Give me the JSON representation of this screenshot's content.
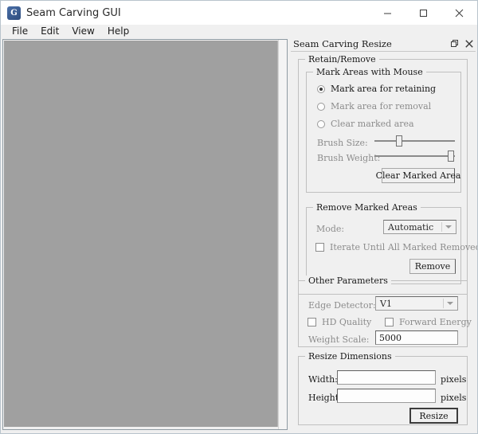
{
  "window": {
    "title": "Seam Carving GUI",
    "app_icon": "app-logo-icon",
    "minimize_icon": "minimize-icon",
    "maximize_icon": "maximize-icon",
    "close_icon": "close-icon"
  },
  "menubar": {
    "items": [
      {
        "label": "File"
      },
      {
        "label": "Edit"
      },
      {
        "label": "View"
      },
      {
        "label": "Help"
      }
    ]
  },
  "canvas": {
    "name": "image-canvas",
    "background_color": "#a0a0a0"
  },
  "dock": {
    "title": "Seam Carving Resize",
    "float_icon": "float-window-icon",
    "close_icon": "close-icon"
  },
  "retain_remove": {
    "title": "Retain/Remove",
    "mark_areas": {
      "title": "Mark Areas with Mouse",
      "radios": [
        {
          "label": "Mark area for retaining",
          "checked": true
        },
        {
          "label": "Mark area for removal",
          "checked": false
        },
        {
          "label": "Clear marked area",
          "checked": false
        }
      ],
      "brush_size_label": "Brush Size:",
      "brush_size_value": 30,
      "brush_weight_label": "Brush Weight:",
      "brush_weight_value": 100,
      "clear_button": "Clear Marked Area"
    },
    "remove_marked": {
      "title": "Remove Marked Areas",
      "mode_label": "Mode:",
      "mode_value": "Automatic",
      "iterate_label": "Iterate Until All Marked Removed",
      "iterate_checked": false,
      "remove_button": "Remove"
    }
  },
  "other_parameters": {
    "title": "Other Parameters",
    "edge_detector_label": "Edge Detector:",
    "edge_detector_value": "V1",
    "hd_quality_label": "HD Quality",
    "hd_quality_checked": false,
    "forward_energy_label": "Forward Energy",
    "forward_energy_checked": false,
    "weight_scale_label": "Weight Scale:",
    "weight_scale_value": "5000"
  },
  "resize_dimensions": {
    "title": "Resize Dimensions",
    "width_label": "Width:",
    "width_value": "",
    "width_unit": "pixels",
    "height_label": "Height:",
    "height_value": "",
    "height_unit": "pixels",
    "resize_button": "Resize"
  }
}
